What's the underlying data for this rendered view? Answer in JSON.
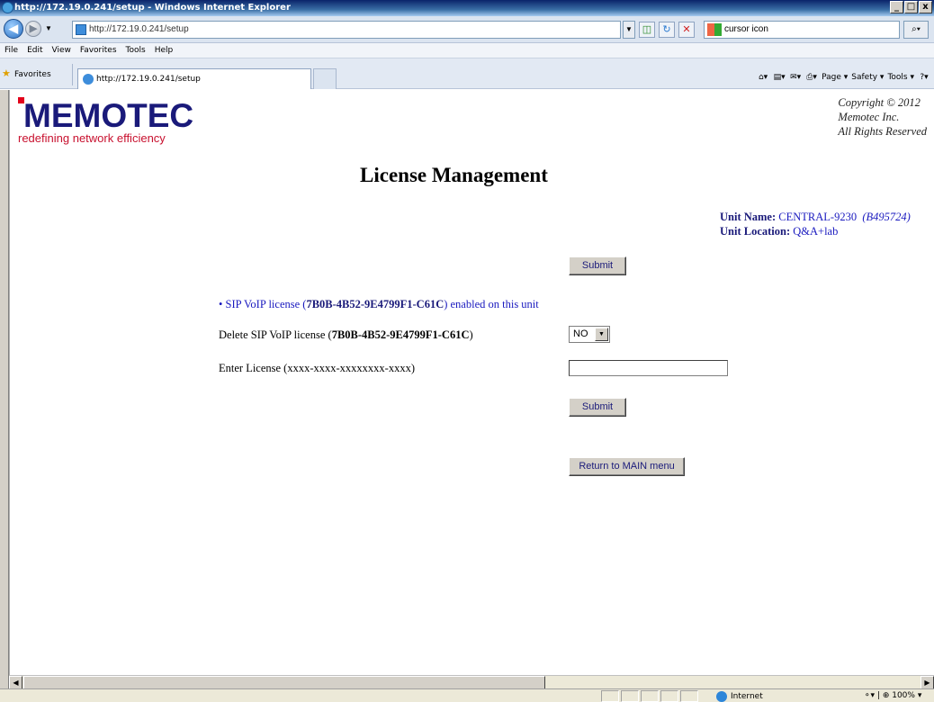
{
  "window": {
    "title": "http://172.19.0.241/setup - Windows Internet Explorer",
    "min": "_",
    "max": "□",
    "close": "x"
  },
  "address_bar": {
    "url": "http://172.19.0.241/setup",
    "search_text": "cursor icon"
  },
  "menu": [
    "File",
    "Edit",
    "View",
    "Favorites",
    "Tools",
    "Help"
  ],
  "favorites_bar": {
    "favorites_label": "Favorites",
    "tab_label": "http://172.19.0.241/setup",
    "commands": {
      "page": "Page ▾",
      "safety": "Safety ▾",
      "tools": "Tools ▾"
    }
  },
  "logo": {
    "name": "MEMOTEC",
    "tagline": "redefining network efficiency"
  },
  "copyright": {
    "line1": "Copyright © 2012",
    "line2": "Memotec Inc.",
    "line3": "All Rights Reserved"
  },
  "page_title": "License Management",
  "unit": {
    "name_label": "Unit Name:",
    "name_value": "CENTRAL-9230",
    "serial": "(B495724)",
    "location_label": "Unit Location:",
    "location_value": "Q&A+lab"
  },
  "buttons": {
    "submit_top": "Submit",
    "submit_bottom": "Submit",
    "return_main": "Return to MAIN menu"
  },
  "license_status": {
    "prefix": "• SIP VoIP license (",
    "key": "7B0B-4B52-9E4799F1-C61C",
    "suffix": ") enabled on this unit"
  },
  "delete_row": {
    "prefix": "Delete SIP VoIP license (",
    "key": "7B0B-4B52-9E4799F1-C61C",
    "suffix": ")",
    "selected": "NO"
  },
  "enter_row": {
    "label": "Enter License (xxxx-xxxx-xxxxxxxx-xxxx)",
    "value": ""
  },
  "status_bar": {
    "zone": "Internet",
    "zoom": "100%"
  }
}
